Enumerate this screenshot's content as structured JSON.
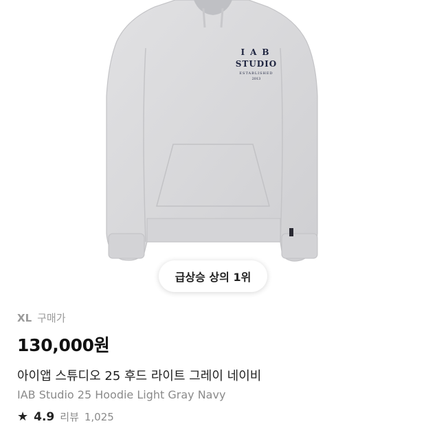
{
  "product": {
    "image_logo": {
      "line1": "IAB",
      "line2": "STUDIO",
      "line3": "ESTABLISHED",
      "line4": "2013"
    },
    "rank_badge": "급상승 상의 1위",
    "size": "XL",
    "purchase_label": "구매가",
    "price": "130,000원",
    "title_ko": "아이앱 스튜디오 25 후드 라이트 그레이 네이비",
    "title_en": "IAB Studio 25 Hoodie Light Gray Navy",
    "rating": "4.9",
    "review_label": "리뷰",
    "review_count": "1,025",
    "colors": {
      "hoodie": "#d9d9db",
      "logo_navy": "#1f2540"
    }
  }
}
